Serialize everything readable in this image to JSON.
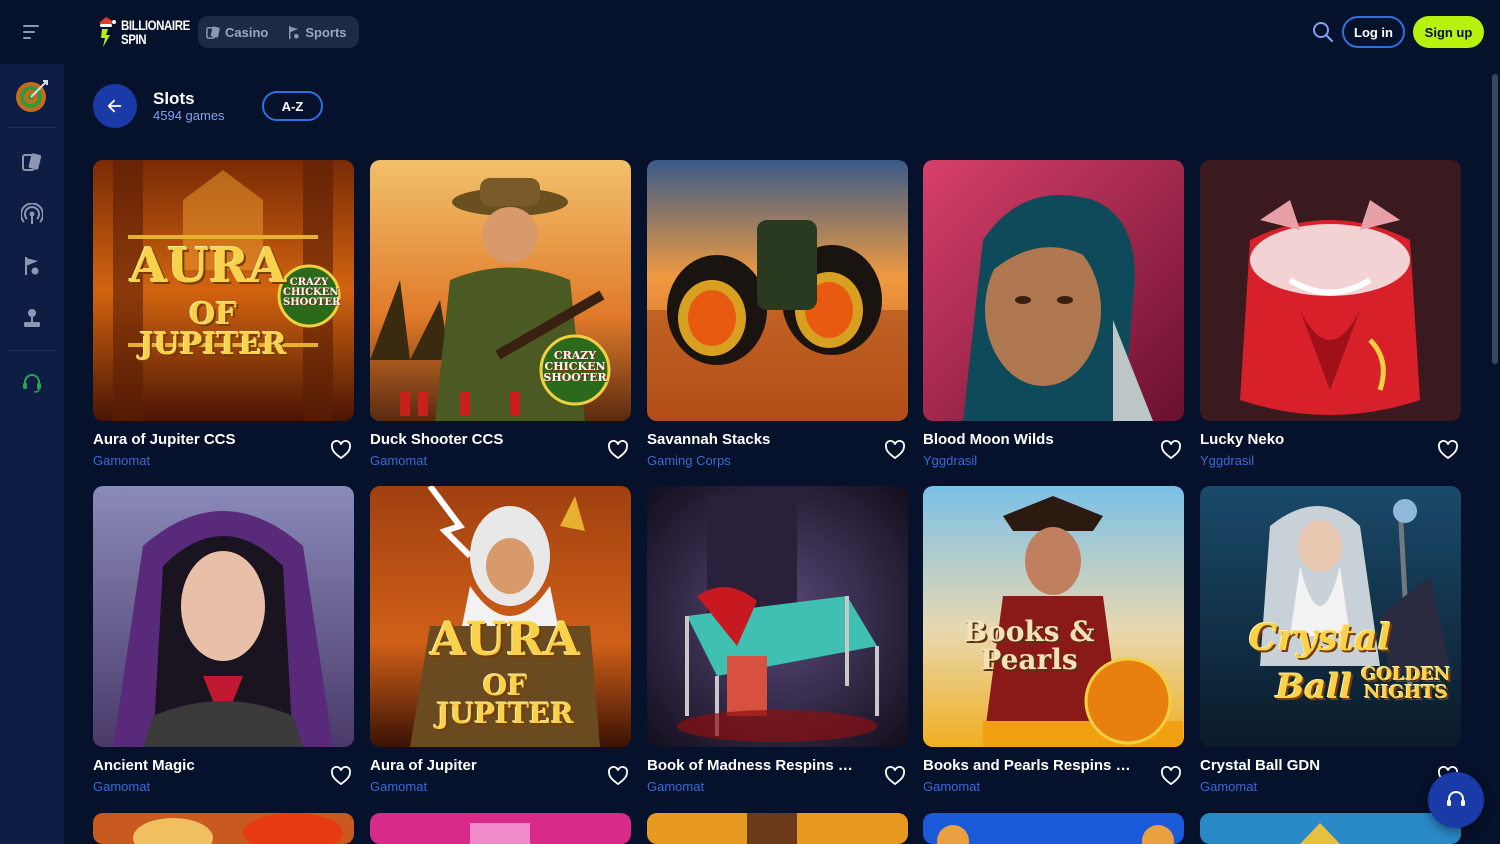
{
  "header": {
    "logo_line1": "BILLIONAIRE",
    "logo_line2": "SPIN",
    "modes": [
      {
        "label": "Casino",
        "icon": "cards-icon"
      },
      {
        "label": "Sports",
        "icon": "sports-icon"
      }
    ],
    "login_label": "Log in",
    "signup_label": "Sign up"
  },
  "sidebar": {
    "items": [
      {
        "name": "target-icon"
      },
      {
        "name": "cards-icon"
      },
      {
        "name": "live-icon"
      },
      {
        "name": "sports-icon"
      },
      {
        "name": "joystick-icon"
      },
      {
        "name": "headset-icon"
      }
    ]
  },
  "page": {
    "title": "Slots",
    "count": "4594 games",
    "sort_label": "A-Z"
  },
  "games": [
    {
      "title": "Aura of Jupiter CCS",
      "provider": "Gamomat"
    },
    {
      "title": "Duck Shooter CCS",
      "provider": "Gamomat"
    },
    {
      "title": "Savannah Stacks",
      "provider": "Gaming Corps"
    },
    {
      "title": "Blood Moon Wilds",
      "provider": "Yggdrasil"
    },
    {
      "title": "Lucky Neko",
      "provider": "Yggdrasil"
    },
    {
      "title": "Ancient Magic",
      "provider": "Gamomat"
    },
    {
      "title": "Aura of Jupiter",
      "provider": "Gamomat"
    },
    {
      "title": "Book of Madness Respins of Amun-Re",
      "provider": "Gamomat"
    },
    {
      "title": "Books and Pearls Respins of Amun-Re",
      "provider": "Gamomat"
    },
    {
      "title": "Crystal Ball GDN",
      "provider": "Gamomat"
    }
  ],
  "thumb_text": {
    "aura_1": "AURA",
    "aura_2": "OF JUPITER",
    "ccs": "CRAZY CHICKEN SHOOTER",
    "books": "Books & Pearls",
    "crystal_1": "Crystal",
    "crystal_2": "Ball",
    "golden": "GOLDEN NIGHTS"
  },
  "colors": {
    "background": "#06112b",
    "sidebar": "#0d1d44",
    "accent_blue": "#1a3aa8",
    "signup_green": "#b6f20b",
    "provider_blue": "#3b6ad6"
  }
}
